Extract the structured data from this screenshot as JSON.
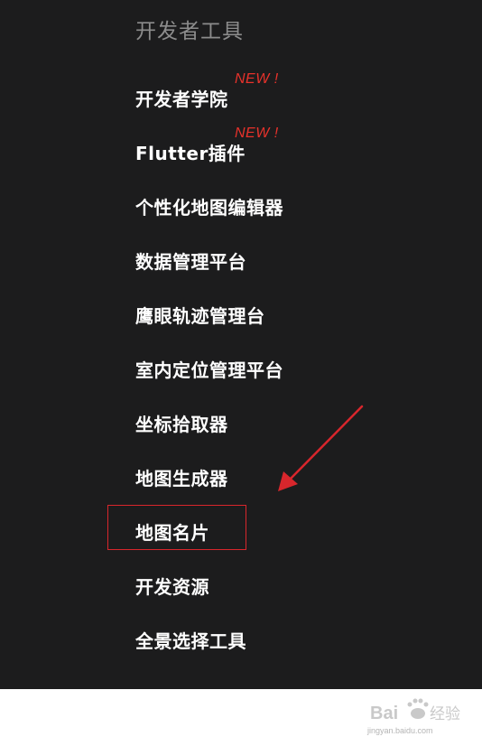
{
  "section": {
    "title": "开发者工具"
  },
  "menu": {
    "items": [
      {
        "label": "开发者学院",
        "badge": "NEW !"
      },
      {
        "label": "Flutter插件",
        "badge": "NEW !"
      },
      {
        "label": "个性化地图编辑器"
      },
      {
        "label": "数据管理平台"
      },
      {
        "label": "鹰眼轨迹管理台"
      },
      {
        "label": "室内定位管理平台"
      },
      {
        "label": "坐标拾取器"
      },
      {
        "label": "地图生成器"
      },
      {
        "label": "地图名片"
      },
      {
        "label": "开发资源"
      },
      {
        "label": "全景选择工具"
      }
    ]
  },
  "colors": {
    "background": "#1c1c1d",
    "title": "#8c8c8c",
    "item": "#ffffff",
    "badge": "#e8322b",
    "annotation": "#d8262c"
  },
  "watermark": {
    "logo": "Bai度经验",
    "url": "jingyan.baidu.com"
  }
}
